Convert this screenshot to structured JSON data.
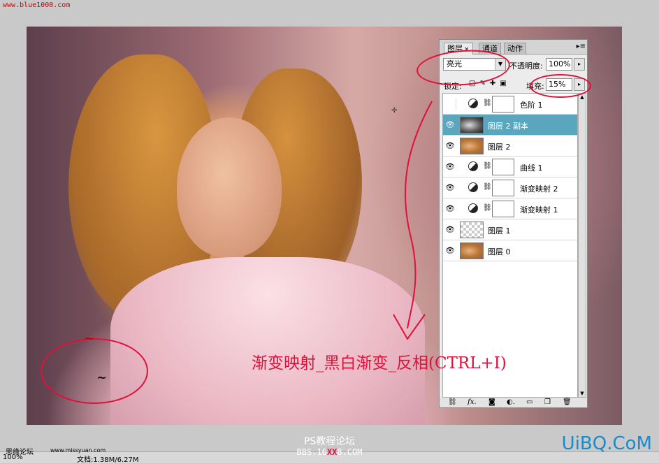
{
  "watermark_top": "www.blue1000.com",
  "panel": {
    "tabs": [
      {
        "label": "图层",
        "close": "×"
      },
      {
        "label": "通道"
      },
      {
        "label": "动作"
      }
    ],
    "blend_mode": "亮光",
    "opacity_label": "不透明度:",
    "opacity_value": "100%",
    "lock_label": "锁定:",
    "fill_label": "填充:",
    "fill_value": "15%",
    "layers": [
      {
        "name": "色阶 1",
        "type": "adjustment",
        "visible": false
      },
      {
        "name": "图层 2 副本",
        "type": "bw",
        "visible": true,
        "selected": true
      },
      {
        "name": "图层 2",
        "type": "photo",
        "visible": true
      },
      {
        "name": "曲线 1",
        "type": "adjustment",
        "visible": true
      },
      {
        "name": "渐变映射 2",
        "type": "adjustment",
        "visible": true
      },
      {
        "name": "渐变映射 1",
        "type": "adjustment",
        "visible": true
      },
      {
        "name": "图层 1",
        "type": "checker",
        "visible": true
      },
      {
        "name": "图层 0",
        "type": "photo",
        "visible": true
      }
    ],
    "bottom_icons": [
      "link-icon",
      "fx-icon",
      "mask-icon",
      "adjustment-icon",
      "folder-icon",
      "new-layer-icon",
      "trash-icon"
    ]
  },
  "annotation": "渐变映射_黑白渐变_反相(CTRL+I)",
  "status": {
    "zoom": "100%",
    "doc": "文档:1.38M/6.27M"
  },
  "watermarks": {
    "left": "思缘论坛",
    "left_small": "www.missyuan.com",
    "center": "PS教程论坛",
    "center2_pre": "BBS.16",
    "center2_mid": "XX",
    "center2_post": "8.COM",
    "right": "UiBQ.CoM"
  },
  "colors": {
    "selection": "#5aa6be",
    "annotation": "#e0103a",
    "brand_right": "#1a8cc9"
  }
}
